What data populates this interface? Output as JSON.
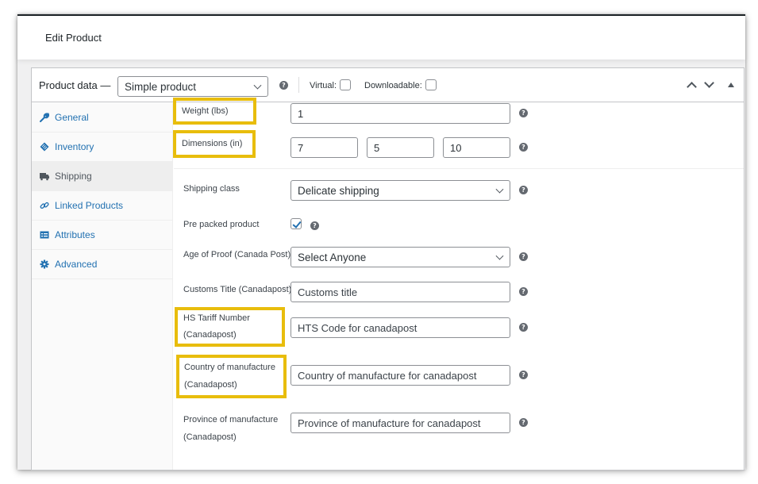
{
  "page": {
    "title": "Edit Product"
  },
  "product_data": {
    "label": "Product data —",
    "type_select": {
      "value": "Simple product"
    },
    "virtual_label": "Virtual:",
    "virtual_checked": false,
    "downloadable_label": "Downloadable:",
    "downloadable_checked": false
  },
  "tabs": [
    {
      "label": "General",
      "icon": "wrench-icon",
      "active": false
    },
    {
      "label": "Inventory",
      "icon": "tag-icon",
      "active": false
    },
    {
      "label": "Shipping",
      "icon": "truck-icon",
      "active": true
    },
    {
      "label": "Linked Products",
      "icon": "link-icon",
      "active": false
    },
    {
      "label": "Attributes",
      "icon": "list-icon",
      "active": false
    },
    {
      "label": "Advanced",
      "icon": "gear-icon",
      "active": false
    }
  ],
  "shipping": {
    "weight": {
      "label": "Weight (lbs)",
      "value": "1"
    },
    "dimensions": {
      "label": "Dimensions (in)",
      "length": "7",
      "width": "5",
      "height": "10"
    },
    "shipping_class": {
      "label": "Shipping class",
      "value": "Delicate shipping"
    },
    "pre_packed": {
      "label": "Pre packed product",
      "checked": true
    },
    "age_of_proof": {
      "label": "Age of Proof (Canada Post)",
      "value": "Select Anyone"
    },
    "customs_title": {
      "label": "Customs Title (Canadapost)",
      "placeholder": "Customs title"
    },
    "hs_tariff": {
      "label_line1": "HS Tariff Number",
      "label_line2": "(Canadapost)",
      "placeholder": "HTS Code for canadapost"
    },
    "country": {
      "label_line1": "Country of manufacture",
      "label_line2": "(Canadapost)",
      "placeholder": "Country of manufacture for canadapost"
    },
    "province": {
      "label_line1": "Province of manufacture",
      "label_line2": "(Canadapost)",
      "placeholder": "Province of manufacture for canadapost"
    }
  },
  "highlight_color": "#e8bd0c",
  "link_color": "#2271b1"
}
